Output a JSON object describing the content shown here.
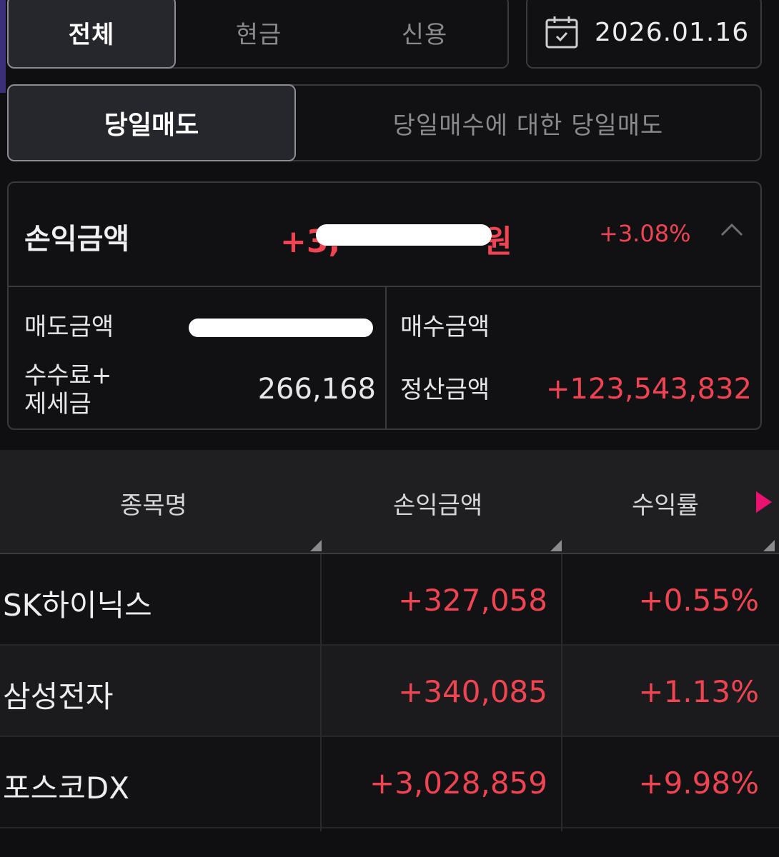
{
  "account_tabs": [
    "전체",
    "현금",
    "신용"
  ],
  "date": "2026.01.16",
  "trade_tabs": [
    "당일매도",
    "당일매수에 대한 당일매도"
  ],
  "summary": {
    "profit_label": "손익금액",
    "profit_prefix": "+3,",
    "profit_suffix": "원",
    "profit_rate": "+3.08%",
    "sell_amount_label": "매도금액",
    "sell_amount_value": "",
    "buy_amount_label": "매수금액",
    "buy_amount_value": "",
    "fee_label_line1": "수수료+",
    "fee_label_line2": "제세금",
    "fee_value": "266,168",
    "settle_label": "정산금액",
    "settle_value": "+123,543,832"
  },
  "table": {
    "headers": [
      "종목명",
      "손익금액",
      "수익률"
    ],
    "rows": [
      {
        "name": "SK하이닉스",
        "profit": "+327,058",
        "rate": "+0.55%"
      },
      {
        "name": "삼성전자",
        "profit": "+340,085",
        "rate": "+1.13%"
      },
      {
        "name": "포스코DX",
        "profit": "+3,028,859",
        "rate": "+9.98%"
      }
    ]
  },
  "colors": {
    "positive": "#f04452",
    "accent_arrow": "#e9136f",
    "background": "#0f0f11"
  },
  "icons": {
    "date": "calendar-icon",
    "collapse": "chevron-up-icon",
    "scroll": "triangle-right-icon"
  }
}
